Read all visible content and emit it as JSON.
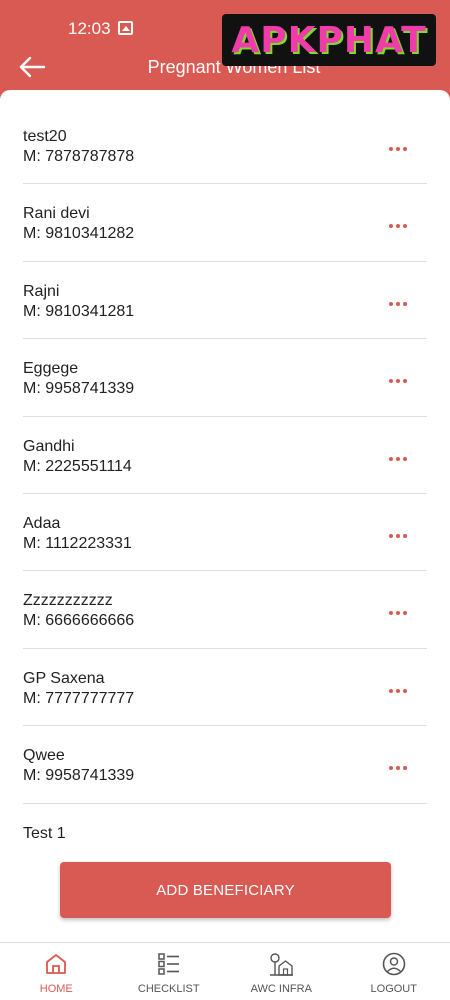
{
  "status_bar": {
    "time": "12:03"
  },
  "header": {
    "title": "Pregnant Women List"
  },
  "watermark": {
    "text": "APKPHAT"
  },
  "beneficiaries": [
    {
      "name": "test20",
      "mobile": "M: 7878787878"
    },
    {
      "name": "Rani devi",
      "mobile": "M: 9810341282"
    },
    {
      "name": "Rajni",
      "mobile": "M: 9810341281"
    },
    {
      "name": "Eggege",
      "mobile": "M: 9958741339"
    },
    {
      "name": "Gandhi",
      "mobile": "M: 2225551114"
    },
    {
      "name": "Adaa",
      "mobile": "M: 1112223331"
    },
    {
      "name": "Zzzzzzzzzzz",
      "mobile": "M: 6666666666"
    },
    {
      "name": "GP Saxena",
      "mobile": "M: 7777777777"
    },
    {
      "name": "Qwee",
      "mobile": "M: 9958741339"
    },
    {
      "name": "Test 1",
      "mobile": ""
    }
  ],
  "add_button": {
    "label": "ADD BENEFICIARY"
  },
  "nav": {
    "items": [
      {
        "label": "HOME",
        "icon": "home-icon",
        "active": true
      },
      {
        "label": "CHECKLIST",
        "icon": "checklist-icon",
        "active": false
      },
      {
        "label": "AWC INFRA",
        "icon": "awc-infra-icon",
        "active": false
      },
      {
        "label": "LOGOUT",
        "icon": "logout-icon",
        "active": false
      }
    ]
  },
  "colors": {
    "accent": "#d95a52",
    "divider": "#dedede",
    "text": "#222222"
  }
}
